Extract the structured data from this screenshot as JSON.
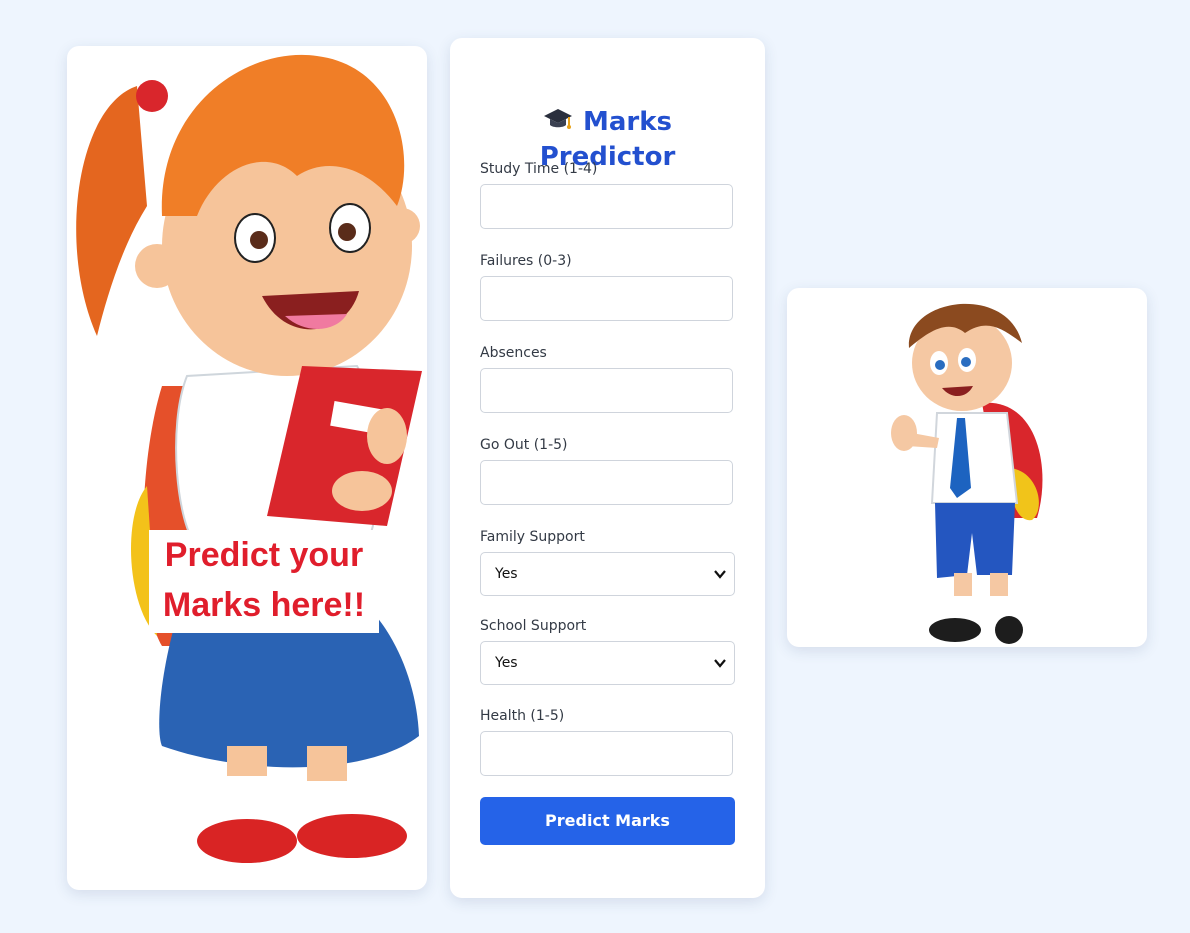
{
  "left_card": {
    "promo_line1": "Predict your",
    "promo_line2": "Marks here!!"
  },
  "form": {
    "title_icon": "graduation-cap-icon",
    "title_line1": "Marks",
    "title_line2": "Predictor",
    "fields": [
      {
        "label": "Study Time (1-4)",
        "value": ""
      },
      {
        "label": "Failures (0-3)",
        "value": ""
      },
      {
        "label": "Absences",
        "value": ""
      },
      {
        "label": "Go Out (1-5)",
        "value": ""
      },
      {
        "label": "Family Support",
        "value": "Yes"
      },
      {
        "label": "School Support",
        "value": "Yes"
      },
      {
        "label": "Health (1-5)",
        "value": ""
      }
    ],
    "submit_label": "Predict Marks"
  },
  "colors": {
    "accent": "#2563e8",
    "title": "#2350cf",
    "background": "#eef5fe"
  }
}
